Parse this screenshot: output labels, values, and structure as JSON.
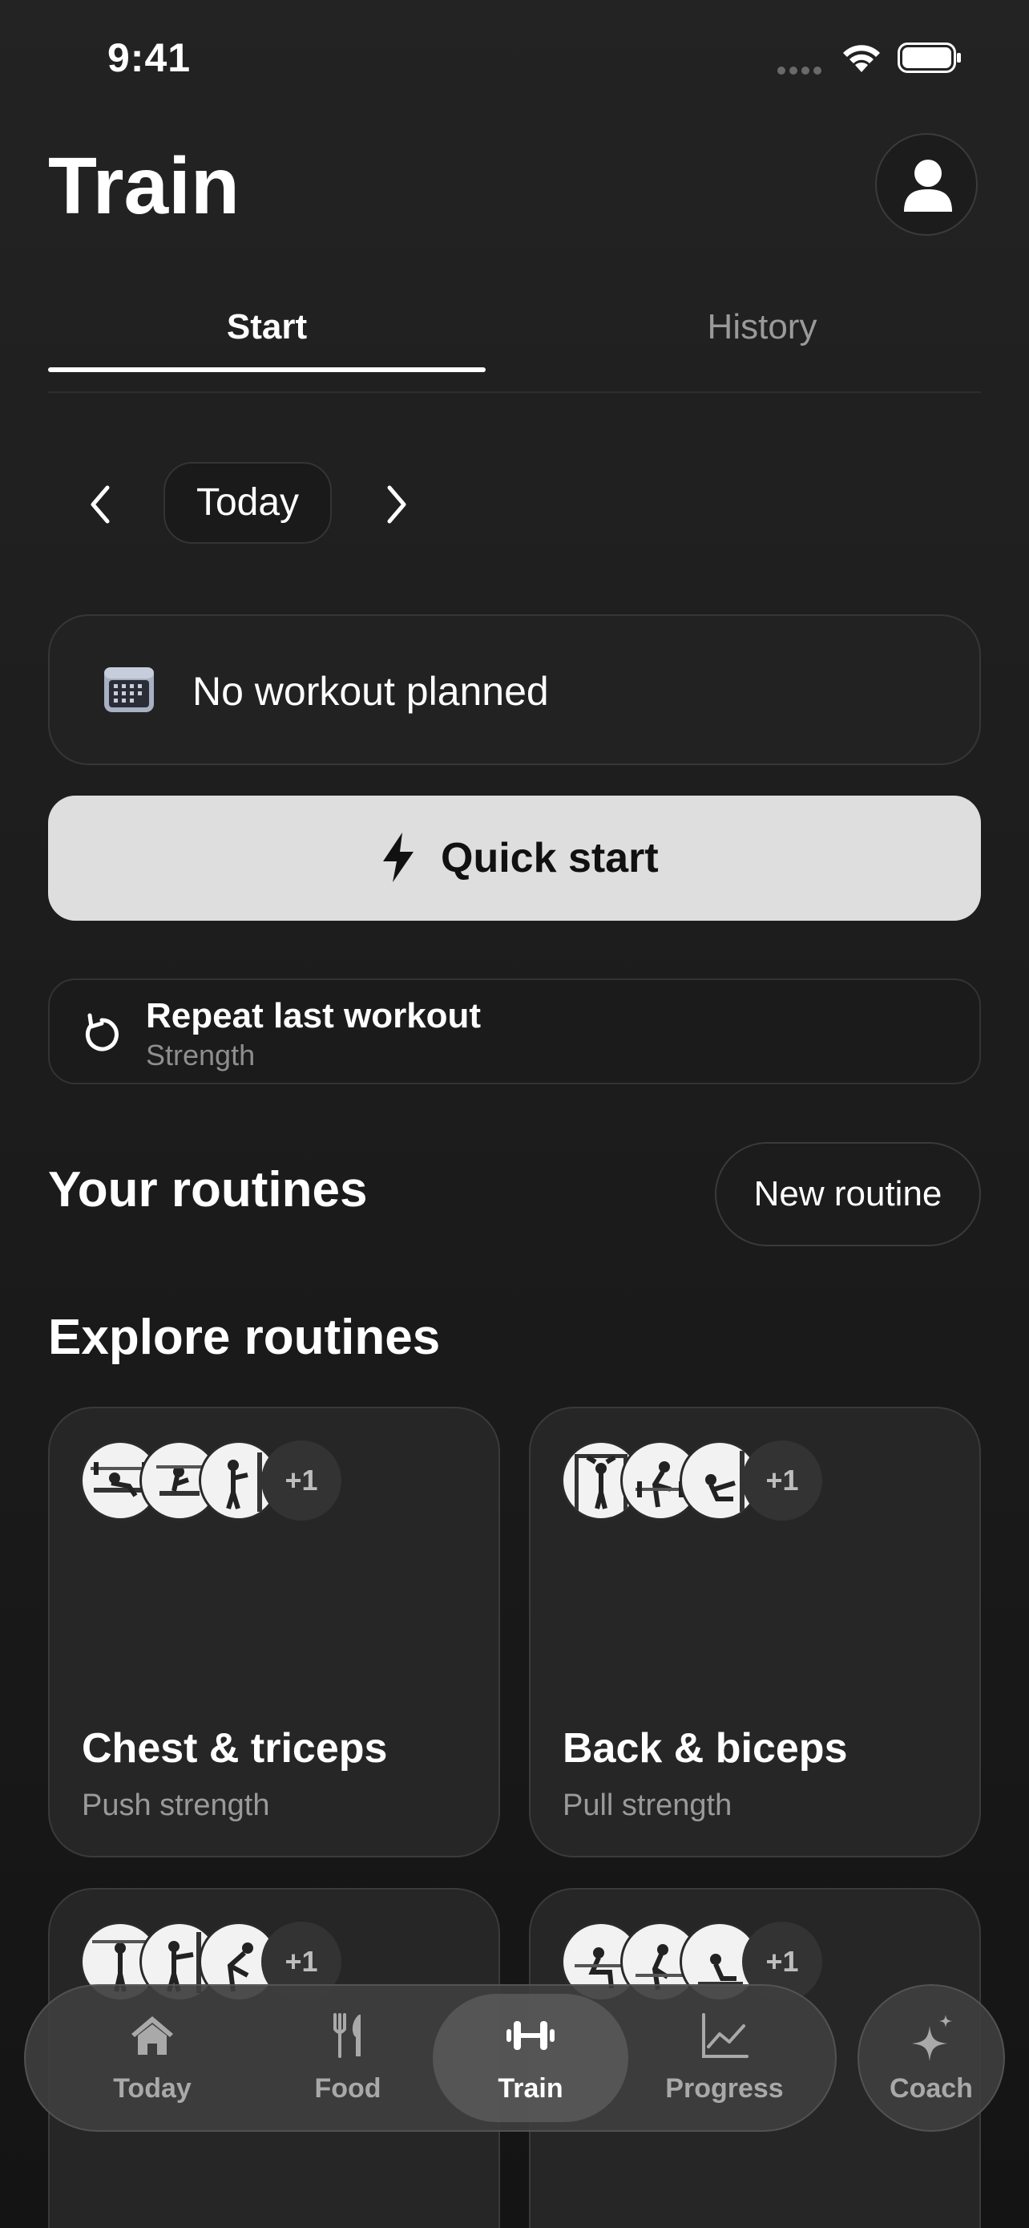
{
  "status_bar": {
    "time": "9:41"
  },
  "header": {
    "title": "Train",
    "profile_icon": "person-icon"
  },
  "tabs": [
    {
      "label": "Start",
      "selected": true
    },
    {
      "label": "History",
      "selected": false
    }
  ],
  "date_nav": {
    "label": "Today"
  },
  "plan": {
    "label": "No workout planned",
    "icon": "calendar-icon"
  },
  "quick_start": {
    "label": "Quick start",
    "icon": "bolt-icon"
  },
  "repeat_last": {
    "title": "Repeat last workout",
    "subtitle": "Strength",
    "icon": "repeat-icon"
  },
  "your_routines": {
    "heading": "Your routines",
    "new_button": "New routine"
  },
  "explore": {
    "heading": "Explore routines",
    "routines": [
      {
        "name": "Chest & triceps",
        "subtitle": "Push strength",
        "more": "+1"
      },
      {
        "name": "Back & biceps",
        "subtitle": "Pull strength",
        "more": "+1"
      },
      {
        "name": "",
        "subtitle": "",
        "more": "+1"
      },
      {
        "name": "",
        "subtitle": "",
        "more": "+1"
      }
    ]
  },
  "bottom_nav": {
    "items": [
      {
        "label": "Today",
        "icon": "home-icon"
      },
      {
        "label": "Food",
        "icon": "fork-knife-icon"
      },
      {
        "label": "Train",
        "icon": "dumbbell-icon",
        "selected": true
      },
      {
        "label": "Progress",
        "icon": "chart-icon"
      }
    ],
    "coach": {
      "label": "Coach",
      "icon": "sparkle-icon"
    }
  },
  "colors": {
    "background": "#1c1c1c",
    "card": "#262626",
    "quick_start_bg": "#dedede",
    "muted_text": "#9a9a9a"
  }
}
